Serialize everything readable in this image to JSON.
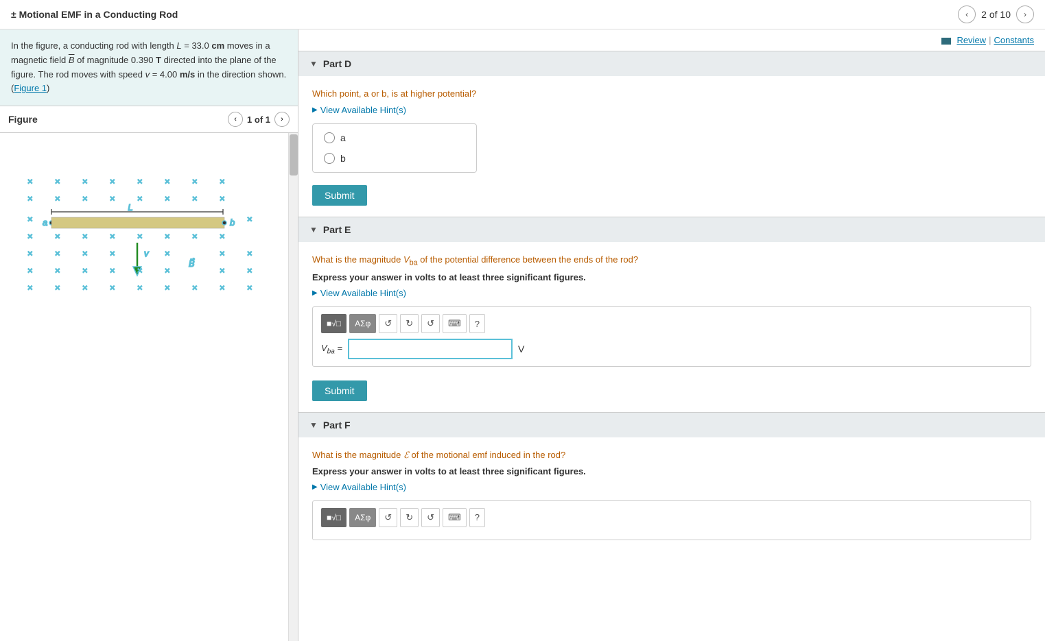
{
  "header": {
    "title": "± Motional EMF in a Conducting Rod",
    "page_indicator": "2 of 10",
    "nav_prev": "‹",
    "nav_next": "›"
  },
  "top_links": {
    "review_label": "Review",
    "constants_label": "Constants",
    "separator": "|"
  },
  "problem_text": {
    "line1": "In the figure, a conducting rod with length L = 33.0 cm moves in a",
    "line2": "magnetic field B̅ of magnitude 0.390 T directed into the plane of the",
    "line3": "figure. The rod moves with speed v = 4.00 m/s in the direction",
    "line4": "shown. (Figure 1)"
  },
  "figure": {
    "title": "Figure",
    "page_indicator": "1 of 1",
    "nav_prev": "‹",
    "nav_next": "›"
  },
  "parts": {
    "part_d": {
      "label": "Part D",
      "question": "Which point, a or b, is at higher potential?",
      "hint_label": "View Available Hint(s)",
      "options": [
        "a",
        "b"
      ],
      "submit_label": "Submit"
    },
    "part_e": {
      "label": "Part E",
      "question_line1": "What is the magnitude Vᴪₐ of the potential difference between the ends of the rod?",
      "question_line2": "Express your answer in volts to at least three significant figures.",
      "hint_label": "View Available Hint(s)",
      "input_label": "V",
      "input_subscript": "ba",
      "input_equals": "=",
      "unit": "V",
      "submit_label": "Submit",
      "toolbar": {
        "btn1": "■√□",
        "btn2": "ΑΣφ",
        "undo": "↺",
        "redo": "↻",
        "reset": "↺",
        "keyboard": "⌨",
        "help": "?"
      }
    },
    "part_f": {
      "label": "Part F",
      "question_line1": "What is the magnitude ℰ of the motional emf induced in the rod?",
      "question_line2": "Express your answer in volts to at least three significant figures.",
      "hint_label": "View Available Hint(s)",
      "toolbar": {
        "btn1": "■√□",
        "btn2": "ΑΣφ",
        "undo": "↺",
        "redo": "↻",
        "reset": "↺",
        "keyboard": "⌨",
        "help": "?"
      }
    }
  }
}
